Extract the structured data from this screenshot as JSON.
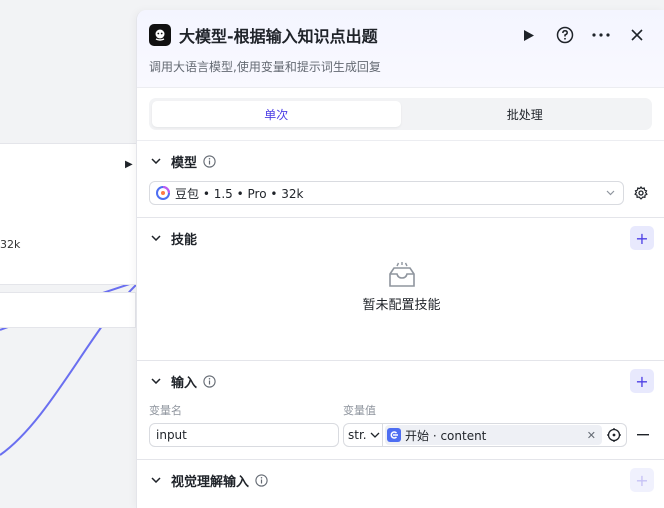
{
  "canvas": {
    "node_meta": "32k"
  },
  "panel": {
    "title": "大模型-根据输入知识点出题",
    "description": "调用大语言模型,使用变量和提示词生成回复",
    "header_icons": [
      "play-icon",
      "help-icon",
      "more-icon",
      "close-icon"
    ],
    "mode_tabs": [
      {
        "label": "单次",
        "active": true
      },
      {
        "label": "批处理",
        "active": false
      }
    ],
    "model": {
      "title": "模型",
      "selected": "豆包 • 1.5 • Pro • 32k"
    },
    "skills": {
      "title": "技能",
      "empty_text": "暂未配置技能"
    },
    "input": {
      "title": "输入",
      "col_name": "变量名",
      "col_value": "变量值",
      "rows": [
        {
          "name": "input",
          "type": "str.",
          "ref": "开始 · content"
        }
      ]
    },
    "vision": {
      "title": "视觉理解输入"
    }
  },
  "colors": {
    "accent": "#4e40e5",
    "accent_soft": "#e8e9fd",
    "border": "#d9dbe0"
  }
}
